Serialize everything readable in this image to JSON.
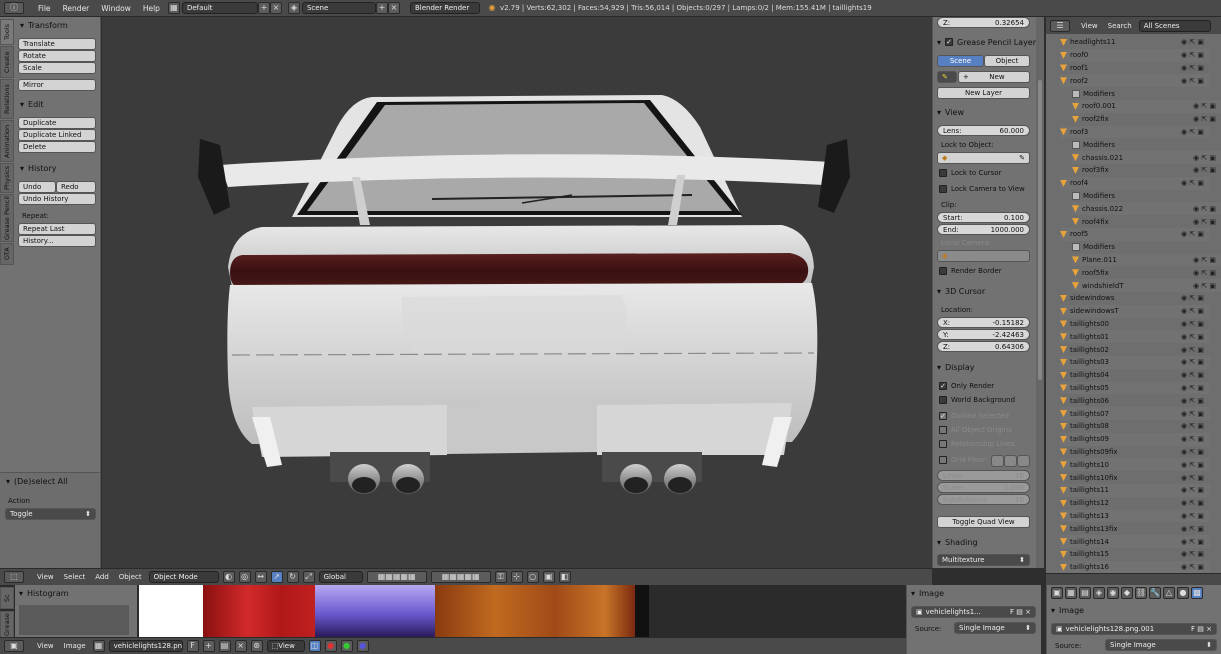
{
  "topbar": {
    "menus": [
      "File",
      "Render",
      "Window",
      "Help"
    ],
    "layout": "Default",
    "scene": "Scene",
    "engine": "Blender Render",
    "stats": "v2.79 | Verts:62,302 | Faces:54,929 | Tris:56,014 | Objects:0/297 | Lamps:0/2 | Mem:155.41M | taillights19"
  },
  "toolshelf": {
    "vtabs": [
      "Tools",
      "Create",
      "Relations",
      "Animation",
      "Physics",
      "Grease Pencil",
      "GTA"
    ],
    "transform": {
      "header": "Transform",
      "buttons": [
        "Translate",
        "Rotate",
        "Scale",
        "Mirror"
      ]
    },
    "edit": {
      "header": "Edit",
      "buttons": [
        "Duplicate",
        "Duplicate Linked",
        "Delete"
      ]
    },
    "history": {
      "header": "History",
      "undo": "Undo",
      "redo": "Redo",
      "undo_history": "Undo History",
      "repeat_label": "Repeat:",
      "repeat_last": "Repeat Last",
      "history_btn": "History..."
    },
    "operator": {
      "header": "(De)select All",
      "action_label": "Action",
      "action_value": "Toggle"
    }
  },
  "viewport_header": {
    "menus": [
      "View",
      "Select",
      "Add",
      "Object"
    ],
    "mode": "Object Mode",
    "orientation": "Global"
  },
  "npanel": {
    "z_label": "Z:",
    "z_value": "0.32654",
    "grease_header": "Grease Pencil Layers",
    "scene_tab": "Scene",
    "object_tab": "Object",
    "new_btn": "New",
    "new_layer": "New Layer",
    "view_header": "View",
    "lens_label": "Lens:",
    "lens_value": "60.000",
    "lock_label": "Lock to Object:",
    "lock_cursor": "Lock to Cursor",
    "lock_camera": "Lock Camera to View",
    "clip_label": "Clip:",
    "start_label": "Start:",
    "start_value": "0.100",
    "end_label": "End:",
    "end_value": "1000.000",
    "local_camera_label": "Local Camera:",
    "local_camera_value": "bodykit6",
    "render_border": "Render Border",
    "cursor_header": "3D Cursor",
    "location_label": "Location:",
    "cx_label": "X:",
    "cx_value": "-0.15182",
    "cy_label": "Y:",
    "cy_value": "-2.42463",
    "cz_label": "Z:",
    "cz_value": "0.64306",
    "display_header": "Display",
    "only_render": "Only Render",
    "world_bg": "World Background",
    "outline_selected": "Outline Selected",
    "all_origins": "All Object Origins",
    "rel_lines": "Relationship Lines",
    "grid_floor": "Grid Floor:",
    "grid_x": "X",
    "grid_y": "Y",
    "grid_z": "Z",
    "lines_label": "Lines:",
    "lines_value": "16",
    "scale_label": "Scale:",
    "scale_value": "1.000",
    "subdiv_label": "Subdivisions:",
    "subdiv_value": "10",
    "toggle_quad": "Toggle Quad View",
    "shading_header": "Shading",
    "shading_value": "Multitexture"
  },
  "outliner": {
    "view_menu": "View",
    "search_menu": "Search",
    "scenes": "All Scenes",
    "rows": [
      {
        "name": "headlights11",
        "type": "obj"
      },
      {
        "name": "roof0",
        "type": "obj"
      },
      {
        "name": "roof1",
        "type": "obj"
      },
      {
        "name": "roof2",
        "type": "obj"
      },
      {
        "name": "Modifiers",
        "type": "mod"
      },
      {
        "name": "roof0.001",
        "type": "obj"
      },
      {
        "name": "roof2fix",
        "type": "obj"
      },
      {
        "name": "roof3",
        "type": "obj"
      },
      {
        "name": "Modifiers",
        "type": "mod"
      },
      {
        "name": "chassis.021",
        "type": "obj"
      },
      {
        "name": "roof3fix",
        "type": "obj"
      },
      {
        "name": "roof4",
        "type": "obj"
      },
      {
        "name": "Modifiers",
        "type": "mod"
      },
      {
        "name": "chassis.022",
        "type": "obj"
      },
      {
        "name": "roof4fix",
        "type": "obj"
      },
      {
        "name": "roof5",
        "type": "obj"
      },
      {
        "name": "Modifiers",
        "type": "mod"
      },
      {
        "name": "Plane.011",
        "type": "obj"
      },
      {
        "name": "roof5fix",
        "type": "obj"
      },
      {
        "name": "windshieldT",
        "type": "obj"
      },
      {
        "name": "sidewindows",
        "type": "obj"
      },
      {
        "name": "sidewindowsT",
        "type": "obj"
      },
      {
        "name": "taillights00",
        "type": "obj"
      },
      {
        "name": "taillights01",
        "type": "obj"
      },
      {
        "name": "taillights02",
        "type": "obj"
      },
      {
        "name": "taillights03",
        "type": "obj"
      },
      {
        "name": "taillights04",
        "type": "obj"
      },
      {
        "name": "taillights05",
        "type": "obj"
      },
      {
        "name": "taillights06",
        "type": "obj"
      },
      {
        "name": "taillights07",
        "type": "obj"
      },
      {
        "name": "taillights08",
        "type": "obj"
      },
      {
        "name": "taillights09",
        "type": "obj"
      },
      {
        "name": "taillights09fix",
        "type": "obj"
      },
      {
        "name": "taillights10",
        "type": "obj"
      },
      {
        "name": "taillights10fix",
        "type": "obj"
      },
      {
        "name": "taillights11",
        "type": "obj"
      },
      {
        "name": "taillights12",
        "type": "obj"
      },
      {
        "name": "taillights13",
        "type": "obj"
      },
      {
        "name": "taillights13fix",
        "type": "obj"
      },
      {
        "name": "taillights14",
        "type": "obj"
      },
      {
        "name": "taillights15",
        "type": "obj"
      },
      {
        "name": "taillights16",
        "type": "obj"
      }
    ]
  },
  "bottom": {
    "histogram_header": "Histogram",
    "vtab_sc": "Sc",
    "vtab_grease": "Grease",
    "image_menus": [
      "View",
      "Image"
    ],
    "image_name": "vehiclelights128.png",
    "image_f": "F",
    "view_dd": "View",
    "image_panel_header": "Image",
    "image_field": "vehiclelights1...",
    "source_label": "Source:",
    "source_value": "Single Image",
    "props_image_header": "Image",
    "props_image_field": "vehiclelights128.png.001",
    "props_source_value": "Single Image"
  }
}
